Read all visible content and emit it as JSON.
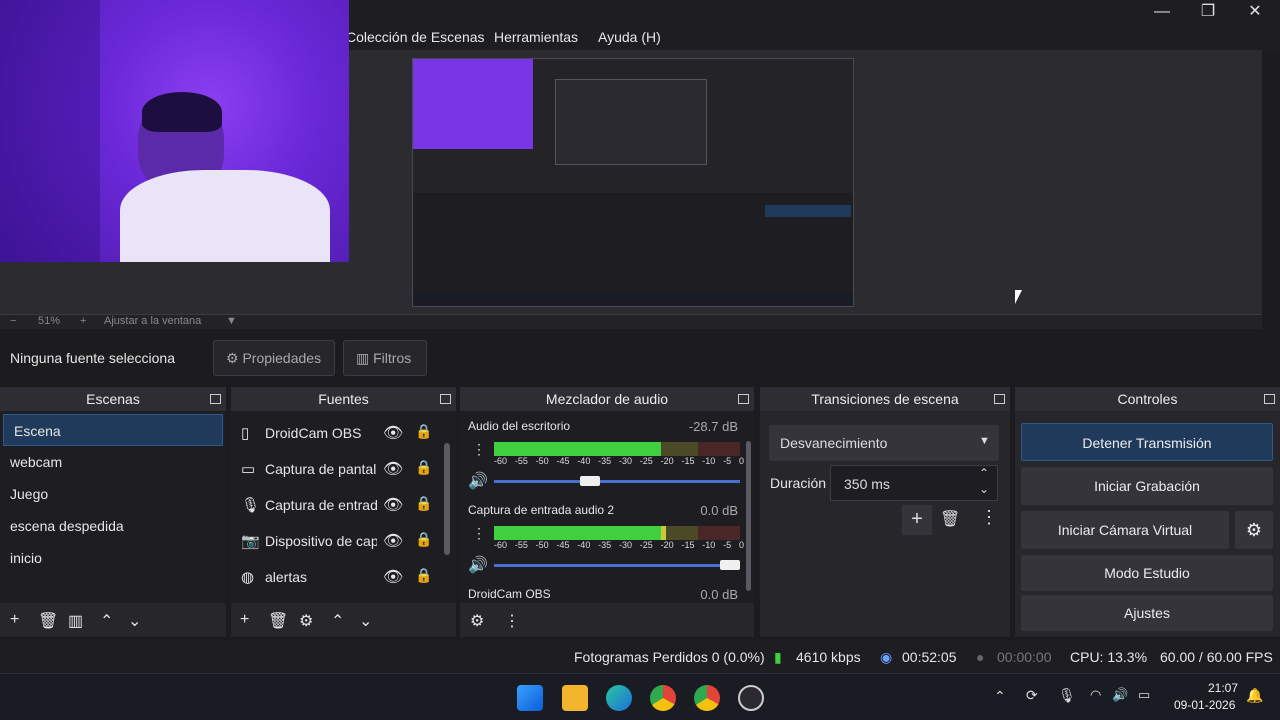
{
  "menu": {
    "items": [
      "Colección de Escenas",
      "Herramientas",
      "Ayuda (H)"
    ]
  },
  "window_controls": {
    "minimize": "—",
    "maximize": "❐",
    "close": "✕"
  },
  "zoom_bar": {
    "minus": "−",
    "zoom": "51%",
    "plus": "+",
    "fit_label": "Ajustar a la ventana"
  },
  "source_bar": {
    "no_source": "Ninguna fuente selecciona",
    "properties": "Propiedades",
    "filters": "Filtros"
  },
  "scenes": {
    "title": "Escenas",
    "items": [
      "Escena",
      "webcam",
      "Juego",
      "escena despedida",
      "inicio"
    ]
  },
  "sources": {
    "title": "Fuentes",
    "items": [
      {
        "label": "DroidCam OBS",
        "icon": "document-icon"
      },
      {
        "label": "Captura de pantall",
        "icon": "monitor-icon"
      },
      {
        "label": "Captura de entrad",
        "icon": "microphone-icon"
      },
      {
        "label": "Dispositivo de capt",
        "icon": "camera-icon"
      },
      {
        "label": "alertas",
        "icon": "globe-icon"
      }
    ]
  },
  "mixer": {
    "title": "Mezclador de audio",
    "channels": [
      {
        "name": "Audio del escritorio",
        "db": "-28.7 dB",
        "level": 0.68,
        "volume": 0.38
      },
      {
        "name": "Captura de entrada audio 2",
        "db": "0.0 dB",
        "level": 0.7,
        "volume": 1.0
      },
      {
        "name": "DroidCam OBS",
        "db": "0.0 dB"
      }
    ],
    "scale": [
      "-60",
      "-55",
      "-50",
      "-45",
      "-40",
      "-35",
      "-30",
      "-25",
      "-20",
      "-15",
      "-10",
      "-5",
      "0"
    ]
  },
  "transitions": {
    "title": "Transiciones de escena",
    "selected": "Desvanecimiento",
    "duration_label": "Duración",
    "duration_value": "350 ms"
  },
  "controls": {
    "title": "Controles",
    "stop_stream": "Detener Transmisión",
    "start_record": "Iniciar Grabación",
    "virtual_cam": "Iniciar Cámara Virtual",
    "studio": "Modo Estudio",
    "settings": "Ajustes"
  },
  "status": {
    "dropped": "Fotogramas Perdidos 0 (0.0%)",
    "bitrate": "4610 kbps",
    "stream_time": "00:52:05",
    "rec_time": "00:00:00",
    "cpu": "CPU: 13.3%",
    "fps": "60.00 / 60.00 FPS"
  },
  "taskbar": {
    "time": "21:07",
    "date": "09-01-2026"
  },
  "colors": {
    "accent": "#1f3a5a",
    "meter_green": "#3fcf3f",
    "meter_yellow": "#c8c83a",
    "meter_red": "#d23a3a"
  }
}
